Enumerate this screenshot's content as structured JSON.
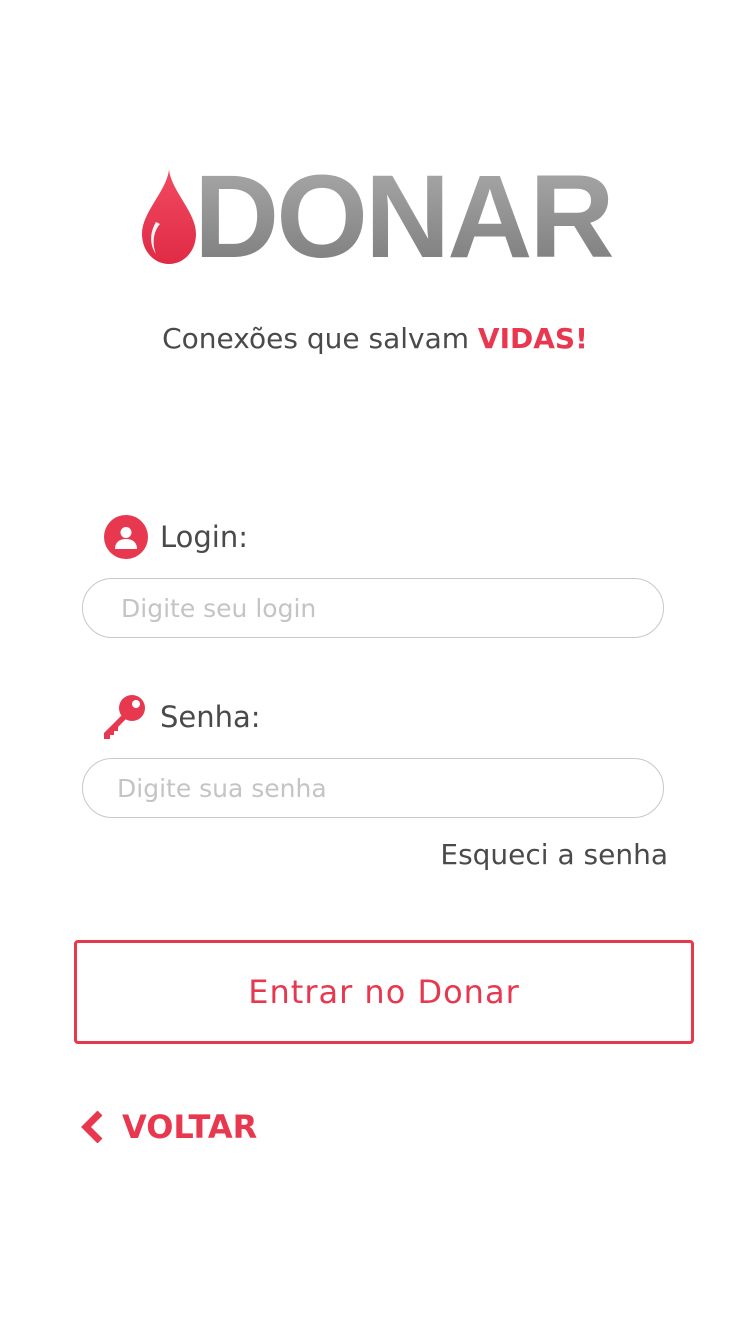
{
  "logo": {
    "text": "DONAR",
    "icon": "blood-drop-icon"
  },
  "tagline": {
    "text": "Conexões que salvam ",
    "accent": "VIDAS!"
  },
  "login": {
    "label": "Login:",
    "icon": "user-icon",
    "placeholder": "Digite seu login",
    "value": ""
  },
  "senha": {
    "label": "Senha:",
    "icon": "key-icon",
    "placeholder": "Digite sua senha",
    "value": ""
  },
  "forgot_label": "Esqueci a senha",
  "enter_button_label": "Entrar no Donar",
  "back": {
    "label": "VOLTAR",
    "icon": "chevron-left-icon"
  },
  "colors": {
    "accent": "#e8384f",
    "logo_gray": "#8c8c8c",
    "text": "#4a4a4a",
    "border": "#c8c8c8"
  }
}
